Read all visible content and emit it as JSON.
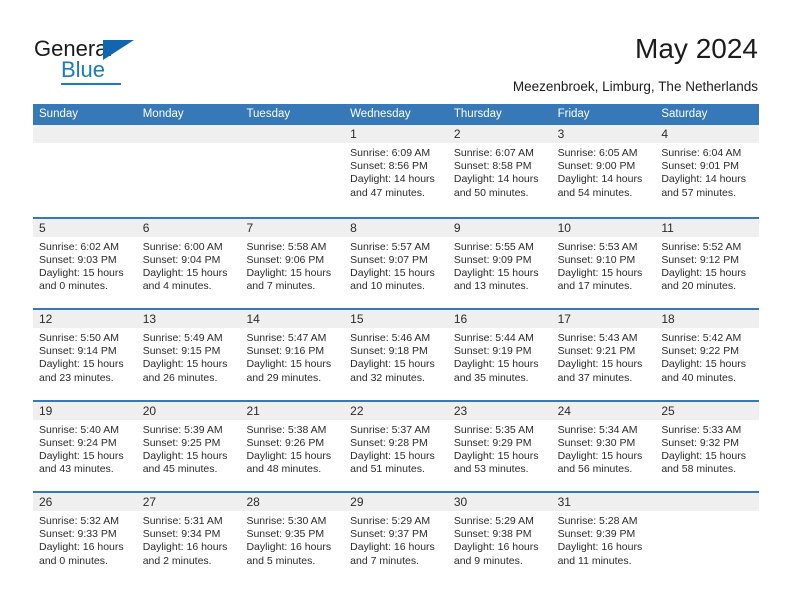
{
  "brand": {
    "name_part1": "General",
    "name_part2": "Blue",
    "triangle_icon": "blue-triangle-icon",
    "color_dark": "#1b1b1b",
    "color_blue": "#1b7ac4"
  },
  "header": {
    "title": "May 2024",
    "subtitle": "Meezenbroek, Limburg, The Netherlands"
  },
  "theme": {
    "header_blue": "#3778b8",
    "day_band_gray": "#efefef",
    "text_color": "#2b2b2b"
  },
  "weekdays": [
    "Sunday",
    "Monday",
    "Tuesday",
    "Wednesday",
    "Thursday",
    "Friday",
    "Saturday"
  ],
  "weeks": [
    [
      {
        "day": "",
        "sunrise": "",
        "sunset": "",
        "daylight1": "",
        "daylight2": "",
        "empty": true
      },
      {
        "day": "",
        "sunrise": "",
        "sunset": "",
        "daylight1": "",
        "daylight2": "",
        "empty": true
      },
      {
        "day": "",
        "sunrise": "",
        "sunset": "",
        "daylight1": "",
        "daylight2": "",
        "empty": true
      },
      {
        "day": "1",
        "sunrise": "Sunrise: 6:09 AM",
        "sunset": "Sunset: 8:56 PM",
        "daylight1": "Daylight: 14 hours",
        "daylight2": "and 47 minutes."
      },
      {
        "day": "2",
        "sunrise": "Sunrise: 6:07 AM",
        "sunset": "Sunset: 8:58 PM",
        "daylight1": "Daylight: 14 hours",
        "daylight2": "and 50 minutes."
      },
      {
        "day": "3",
        "sunrise": "Sunrise: 6:05 AM",
        "sunset": "Sunset: 9:00 PM",
        "daylight1": "Daylight: 14 hours",
        "daylight2": "and 54 minutes."
      },
      {
        "day": "4",
        "sunrise": "Sunrise: 6:04 AM",
        "sunset": "Sunset: 9:01 PM",
        "daylight1": "Daylight: 14 hours",
        "daylight2": "and 57 minutes."
      }
    ],
    [
      {
        "day": "5",
        "sunrise": "Sunrise: 6:02 AM",
        "sunset": "Sunset: 9:03 PM",
        "daylight1": "Daylight: 15 hours",
        "daylight2": "and 0 minutes."
      },
      {
        "day": "6",
        "sunrise": "Sunrise: 6:00 AM",
        "sunset": "Sunset: 9:04 PM",
        "daylight1": "Daylight: 15 hours",
        "daylight2": "and 4 minutes."
      },
      {
        "day": "7",
        "sunrise": "Sunrise: 5:58 AM",
        "sunset": "Sunset: 9:06 PM",
        "daylight1": "Daylight: 15 hours",
        "daylight2": "and 7 minutes."
      },
      {
        "day": "8",
        "sunrise": "Sunrise: 5:57 AM",
        "sunset": "Sunset: 9:07 PM",
        "daylight1": "Daylight: 15 hours",
        "daylight2": "and 10 minutes."
      },
      {
        "day": "9",
        "sunrise": "Sunrise: 5:55 AM",
        "sunset": "Sunset: 9:09 PM",
        "daylight1": "Daylight: 15 hours",
        "daylight2": "and 13 minutes."
      },
      {
        "day": "10",
        "sunrise": "Sunrise: 5:53 AM",
        "sunset": "Sunset: 9:10 PM",
        "daylight1": "Daylight: 15 hours",
        "daylight2": "and 17 minutes."
      },
      {
        "day": "11",
        "sunrise": "Sunrise: 5:52 AM",
        "sunset": "Sunset: 9:12 PM",
        "daylight1": "Daylight: 15 hours",
        "daylight2": "and 20 minutes."
      }
    ],
    [
      {
        "day": "12",
        "sunrise": "Sunrise: 5:50 AM",
        "sunset": "Sunset: 9:14 PM",
        "daylight1": "Daylight: 15 hours",
        "daylight2": "and 23 minutes."
      },
      {
        "day": "13",
        "sunrise": "Sunrise: 5:49 AM",
        "sunset": "Sunset: 9:15 PM",
        "daylight1": "Daylight: 15 hours",
        "daylight2": "and 26 minutes."
      },
      {
        "day": "14",
        "sunrise": "Sunrise: 5:47 AM",
        "sunset": "Sunset: 9:16 PM",
        "daylight1": "Daylight: 15 hours",
        "daylight2": "and 29 minutes."
      },
      {
        "day": "15",
        "sunrise": "Sunrise: 5:46 AM",
        "sunset": "Sunset: 9:18 PM",
        "daylight1": "Daylight: 15 hours",
        "daylight2": "and 32 minutes."
      },
      {
        "day": "16",
        "sunrise": "Sunrise: 5:44 AM",
        "sunset": "Sunset: 9:19 PM",
        "daylight1": "Daylight: 15 hours",
        "daylight2": "and 35 minutes."
      },
      {
        "day": "17",
        "sunrise": "Sunrise: 5:43 AM",
        "sunset": "Sunset: 9:21 PM",
        "daylight1": "Daylight: 15 hours",
        "daylight2": "and 37 minutes."
      },
      {
        "day": "18",
        "sunrise": "Sunrise: 5:42 AM",
        "sunset": "Sunset: 9:22 PM",
        "daylight1": "Daylight: 15 hours",
        "daylight2": "and 40 minutes."
      }
    ],
    [
      {
        "day": "19",
        "sunrise": "Sunrise: 5:40 AM",
        "sunset": "Sunset: 9:24 PM",
        "daylight1": "Daylight: 15 hours",
        "daylight2": "and 43 minutes."
      },
      {
        "day": "20",
        "sunrise": "Sunrise: 5:39 AM",
        "sunset": "Sunset: 9:25 PM",
        "daylight1": "Daylight: 15 hours",
        "daylight2": "and 45 minutes."
      },
      {
        "day": "21",
        "sunrise": "Sunrise: 5:38 AM",
        "sunset": "Sunset: 9:26 PM",
        "daylight1": "Daylight: 15 hours",
        "daylight2": "and 48 minutes."
      },
      {
        "day": "22",
        "sunrise": "Sunrise: 5:37 AM",
        "sunset": "Sunset: 9:28 PM",
        "daylight1": "Daylight: 15 hours",
        "daylight2": "and 51 minutes."
      },
      {
        "day": "23",
        "sunrise": "Sunrise: 5:35 AM",
        "sunset": "Sunset: 9:29 PM",
        "daylight1": "Daylight: 15 hours",
        "daylight2": "and 53 minutes."
      },
      {
        "day": "24",
        "sunrise": "Sunrise: 5:34 AM",
        "sunset": "Sunset: 9:30 PM",
        "daylight1": "Daylight: 15 hours",
        "daylight2": "and 56 minutes."
      },
      {
        "day": "25",
        "sunrise": "Sunrise: 5:33 AM",
        "sunset": "Sunset: 9:32 PM",
        "daylight1": "Daylight: 15 hours",
        "daylight2": "and 58 minutes."
      }
    ],
    [
      {
        "day": "26",
        "sunrise": "Sunrise: 5:32 AM",
        "sunset": "Sunset: 9:33 PM",
        "daylight1": "Daylight: 16 hours",
        "daylight2": "and 0 minutes."
      },
      {
        "day": "27",
        "sunrise": "Sunrise: 5:31 AM",
        "sunset": "Sunset: 9:34 PM",
        "daylight1": "Daylight: 16 hours",
        "daylight2": "and 2 minutes."
      },
      {
        "day": "28",
        "sunrise": "Sunrise: 5:30 AM",
        "sunset": "Sunset: 9:35 PM",
        "daylight1": "Daylight: 16 hours",
        "daylight2": "and 5 minutes."
      },
      {
        "day": "29",
        "sunrise": "Sunrise: 5:29 AM",
        "sunset": "Sunset: 9:37 PM",
        "daylight1": "Daylight: 16 hours",
        "daylight2": "and 7 minutes."
      },
      {
        "day": "30",
        "sunrise": "Sunrise: 5:29 AM",
        "sunset": "Sunset: 9:38 PM",
        "daylight1": "Daylight: 16 hours",
        "daylight2": "and 9 minutes."
      },
      {
        "day": "31",
        "sunrise": "Sunrise: 5:28 AM",
        "sunset": "Sunset: 9:39 PM",
        "daylight1": "Daylight: 16 hours",
        "daylight2": "and 11 minutes."
      },
      {
        "day": "",
        "sunrise": "",
        "sunset": "",
        "daylight1": "",
        "daylight2": "",
        "empty": true
      }
    ]
  ]
}
